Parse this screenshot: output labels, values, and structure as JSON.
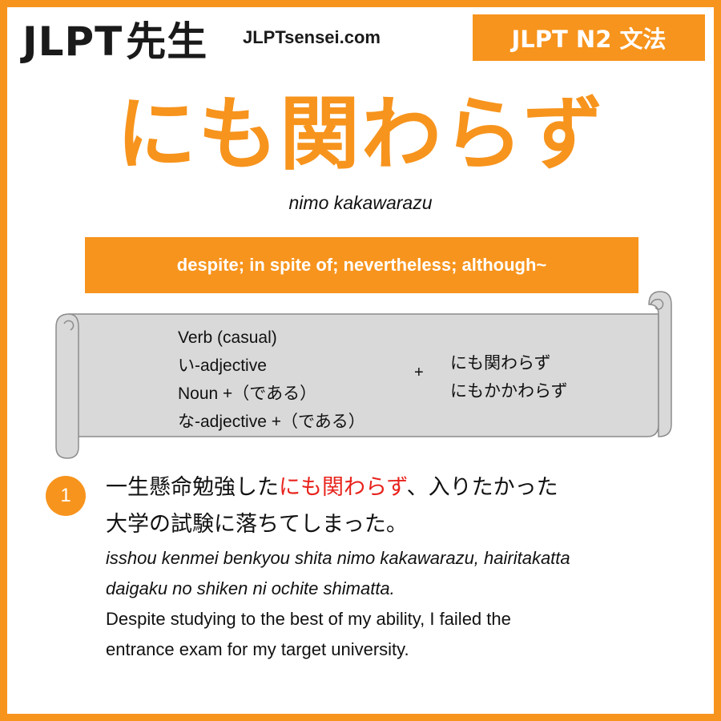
{
  "header": {
    "logo_text": "JLPT",
    "logo_kanji": "先生",
    "site": "JLPTsensei.com",
    "level_badge": "JLPT N2 文法"
  },
  "grammar": {
    "title": "にも関わらず",
    "romaji": "nimo kakawarazu",
    "meaning": "despite; in spite of; nevertheless; although~"
  },
  "formation": {
    "forms": [
      "Verb (casual)",
      "い-adjective",
      "Noun +（である）",
      "な-adjective +（である）"
    ],
    "plus": "+",
    "patterns": [
      "にも関わらず",
      "にもかかわらず"
    ]
  },
  "example": {
    "number": "1",
    "jp_line1_before": "一生懸命勉強した",
    "jp_line1_highlight": "にも関わらず",
    "jp_line1_after": "、入りたかった",
    "jp_line2": "大学の試験に落ちてしまった。",
    "romaji_lines": [
      "isshou kenmei benkyou shita nimo kakawarazu, hairitakatta",
      "daigaku no shiken ni ochite shimatta."
    ],
    "english_lines": [
      "Despite studying to the best of my ability, I failed the",
      "entrance exam for my target university."
    ]
  },
  "colors": {
    "accent": "#f7941d",
    "highlight": "#e8231c",
    "scroll_fill": "#d9d9d9",
    "scroll_stroke": "#8c8c8c"
  }
}
